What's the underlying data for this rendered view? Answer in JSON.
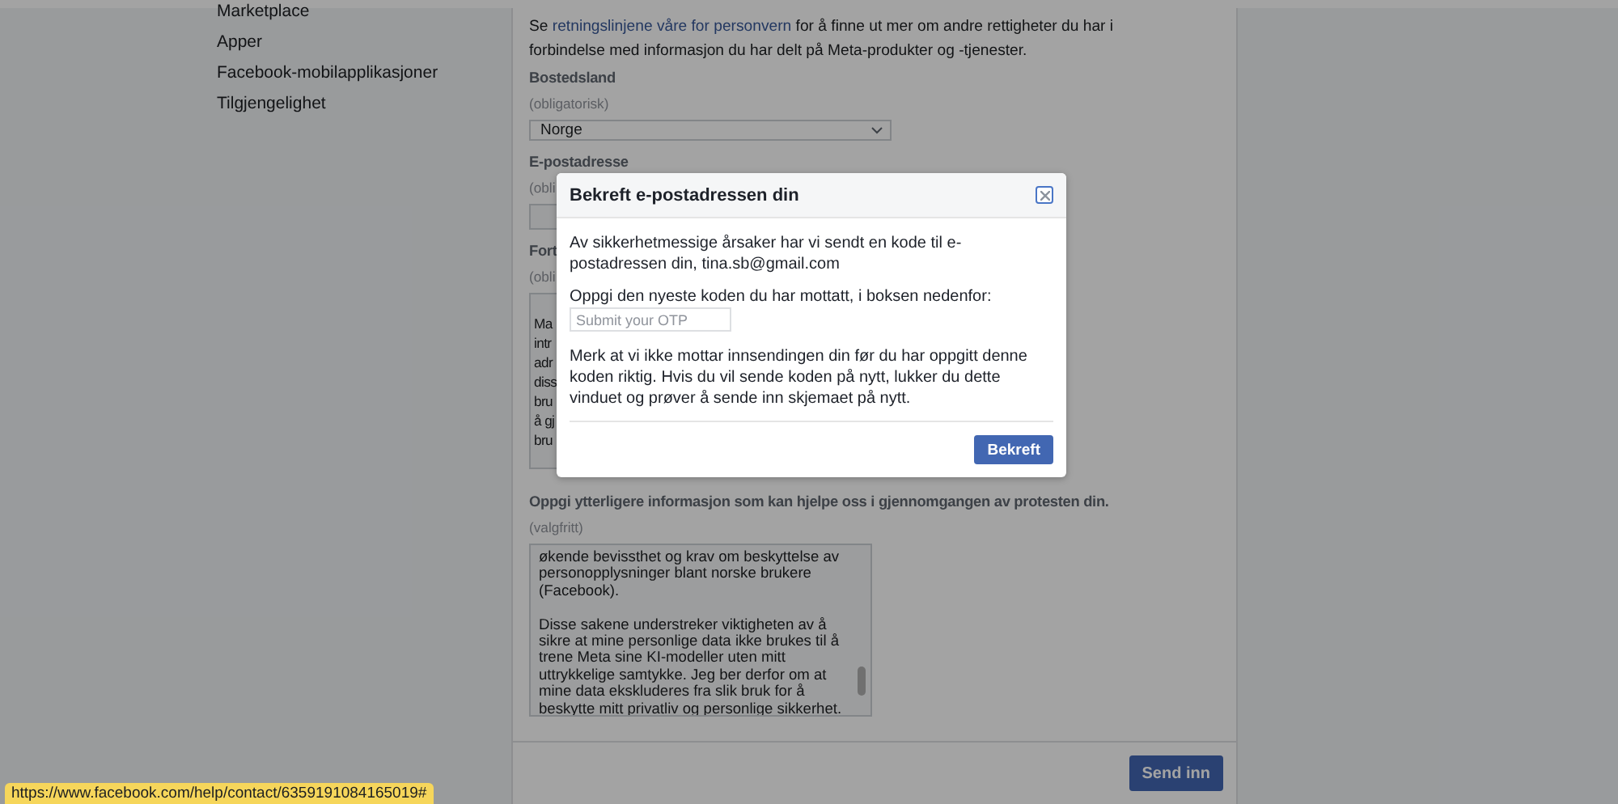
{
  "sidebar": {
    "items": [
      {
        "label": "Marketplace"
      },
      {
        "label": "Apper"
      },
      {
        "label": "Facebook-mobilapplikasjoner"
      },
      {
        "label": "Tilgjengelighet"
      }
    ]
  },
  "form": {
    "intro_before": "Se ",
    "intro_link": "retningslinjene våre for personvern",
    "intro_after": " for å finne ut mer om andre rettigheter du har i forbindelse med informasjon du har delt på Meta-produkter og -tjenester.",
    "fields": [
      {
        "kind": "select",
        "label": "Bostedsland",
        "hint": "(obligatorisk)",
        "value": "Norge"
      },
      {
        "kind": "input",
        "label": "E-postadresse",
        "hint": "(obli"
      },
      {
        "kind": "textarea",
        "label": "Fort",
        "hint": "(obli",
        "lines": [
          "Ma",
          "intr",
          "adr",
          "diss",
          "bru",
          "å gj",
          "bru"
        ]
      },
      {
        "kind": "textarea",
        "label": "Oppgi ytterligere informasjon som kan hjelpe oss i gjennomgangen av protesten din.",
        "hint": "(valgfritt)",
        "paragraphs": [
          "økende bevissthet og krav om beskyttelse av personopplysninger blant norske brukere (Facebook).",
          "Disse sakene understreker viktigheten av å sikre at mine personlige data ikke brukes til å trene Meta sine KI-modeller uten mitt uttrykkelige samtykke. Jeg ber derfor om at mine data ekskluderes fra slik bruk for å beskytte mitt privatliv og personlige sikkerhet."
        ]
      }
    ],
    "submit_button": "Send inn"
  },
  "dialog": {
    "title": "Bekreft e-postadressen din",
    "message": "Av sikkerhetmessige årsaker har vi sendt en kode til e-postadressen din, tina.sb@gmail.com",
    "prompt": "Oppgi den nyeste koden du har mottatt, i boksen nedenfor:",
    "otp_field": {
      "placeholder": "Submit your OTP"
    },
    "note": "Merk at vi ikke mottar innsendingen din før du har oppgitt denne koden riktig. Hvis du vil sende koden på nytt, lukker du dette vinduet og prøver å sende inn skjemaet på nytt.",
    "confirm_button": "Bekreft"
  },
  "status_url": "https://www.facebook.com/help/contact/6359191084165019#"
}
